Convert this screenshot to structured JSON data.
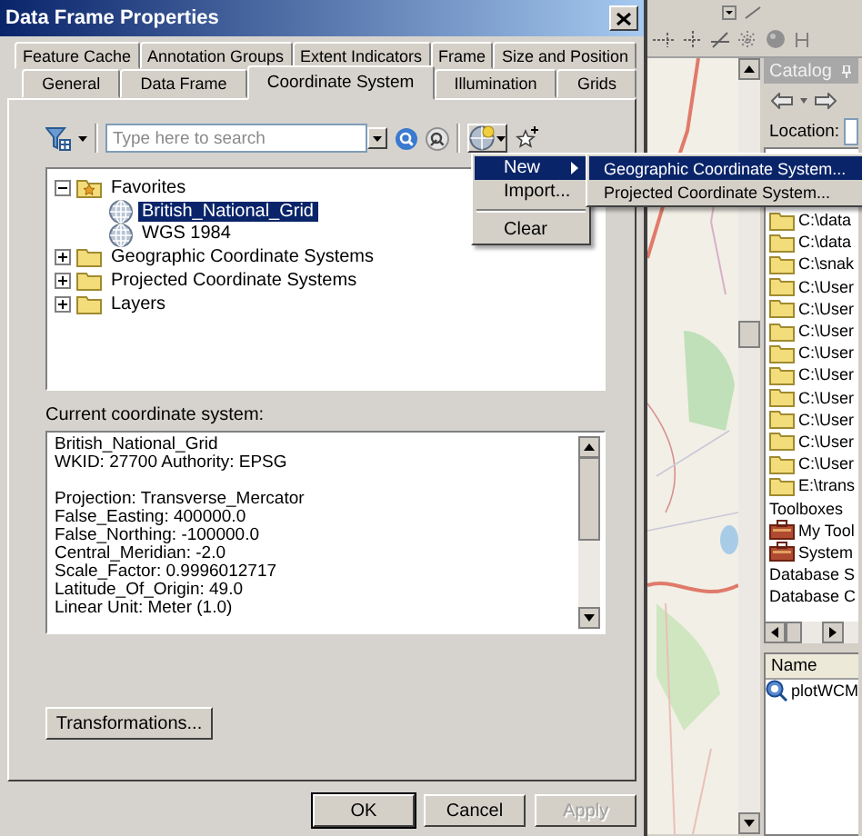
{
  "window": {
    "title": "Data Frame Properties"
  },
  "tab_rows": [
    {
      "tabs": [
        {
          "label": "Feature Cache",
          "selected": false
        },
        {
          "label": "Annotation Groups",
          "selected": false
        },
        {
          "label": "Extent Indicators",
          "selected": false
        },
        {
          "label": "Frame",
          "selected": false
        },
        {
          "label": "Size and Position",
          "selected": false
        }
      ]
    },
    {
      "tabs": [
        {
          "label": "General",
          "selected": false
        },
        {
          "label": "Data Frame",
          "selected": false
        },
        {
          "label": "Coordinate System",
          "selected": true
        },
        {
          "label": "Illumination",
          "selected": false
        },
        {
          "label": "Grids",
          "selected": false
        }
      ]
    }
  ],
  "search": {
    "placeholder": "Type here to search"
  },
  "tree": [
    {
      "label": "Favorites",
      "kind": "favorites",
      "expanded": true,
      "selected": false,
      "children": [
        {
          "label": "British_National_Grid",
          "kind": "coordinate-system",
          "selected": true
        },
        {
          "label": "WGS 1984",
          "kind": "coordinate-system",
          "selected": false
        }
      ]
    },
    {
      "label": "Geographic Coordinate Systems",
      "kind": "folder",
      "expanded": false,
      "selected": false
    },
    {
      "label": "Projected Coordinate Systems",
      "kind": "folder",
      "expanded": false,
      "selected": false
    },
    {
      "label": "Layers",
      "kind": "folder",
      "expanded": false,
      "selected": false
    }
  ],
  "current_system": {
    "label": "Current coordinate system:",
    "paragraphs": [
      {
        "lines": [
          "British_National_Grid",
          "WKID: 27700 Authority: EPSG"
        ]
      },
      {
        "lines": [
          "Projection: Transverse_Mercator",
          "False_Easting: 400000.0",
          "False_Northing: -100000.0",
          "Central_Meridian: -2.0",
          "Scale_Factor: 0.9996012717",
          "Latitude_Of_Origin: 49.0",
          "Linear Unit: Meter (1.0)"
        ]
      }
    ]
  },
  "transformations_button": "Transformations...",
  "buttons": [
    {
      "label": "OK",
      "default": true,
      "disabled": false
    },
    {
      "label": "Cancel",
      "default": false,
      "disabled": false
    },
    {
      "label": "Apply",
      "default": false,
      "disabled": true
    }
  ],
  "menu": {
    "items": [
      {
        "label": "New",
        "kind": "submenu",
        "selected": true
      },
      {
        "label": "Import...",
        "kind": "item",
        "selected": false
      },
      {
        "kind": "separator"
      },
      {
        "label": "Clear",
        "kind": "item",
        "selected": false
      }
    ]
  },
  "submenu": {
    "items": [
      {
        "label": "Geographic Coordinate System...",
        "selected": true
      },
      {
        "label": "Projected Coordinate System...",
        "selected": false
      }
    ]
  },
  "catalog": {
    "title": "Catalog",
    "location_label": "Location:",
    "items": [
      {
        "label": "C:\\data",
        "kind": "folder"
      },
      {
        "label": "C:\\data",
        "kind": "folder"
      },
      {
        "label": "C:\\snak",
        "kind": "folder"
      },
      {
        "label": "C:\\User",
        "kind": "folder"
      },
      {
        "label": "C:\\User",
        "kind": "folder"
      },
      {
        "label": "C:\\User",
        "kind": "folder"
      },
      {
        "label": "C:\\User",
        "kind": "folder"
      },
      {
        "label": "C:\\User",
        "kind": "folder"
      },
      {
        "label": "C:\\User",
        "kind": "folder"
      },
      {
        "label": "C:\\User",
        "kind": "folder"
      },
      {
        "label": "C:\\User",
        "kind": "folder"
      },
      {
        "label": "C:\\User",
        "kind": "folder"
      },
      {
        "label": "E:\\trans",
        "kind": "folder"
      },
      {
        "label": "Toolboxes",
        "kind": "plain"
      },
      {
        "label": "My Tool",
        "kind": "toolbox"
      },
      {
        "label": "System",
        "kind": "toolbox"
      },
      {
        "label": "Database S",
        "kind": "plain"
      },
      {
        "label": "Database C",
        "kind": "plain"
      }
    ],
    "contents": {
      "column": "Name",
      "items": [
        {
          "label": "plotWCM"
        }
      ]
    }
  }
}
